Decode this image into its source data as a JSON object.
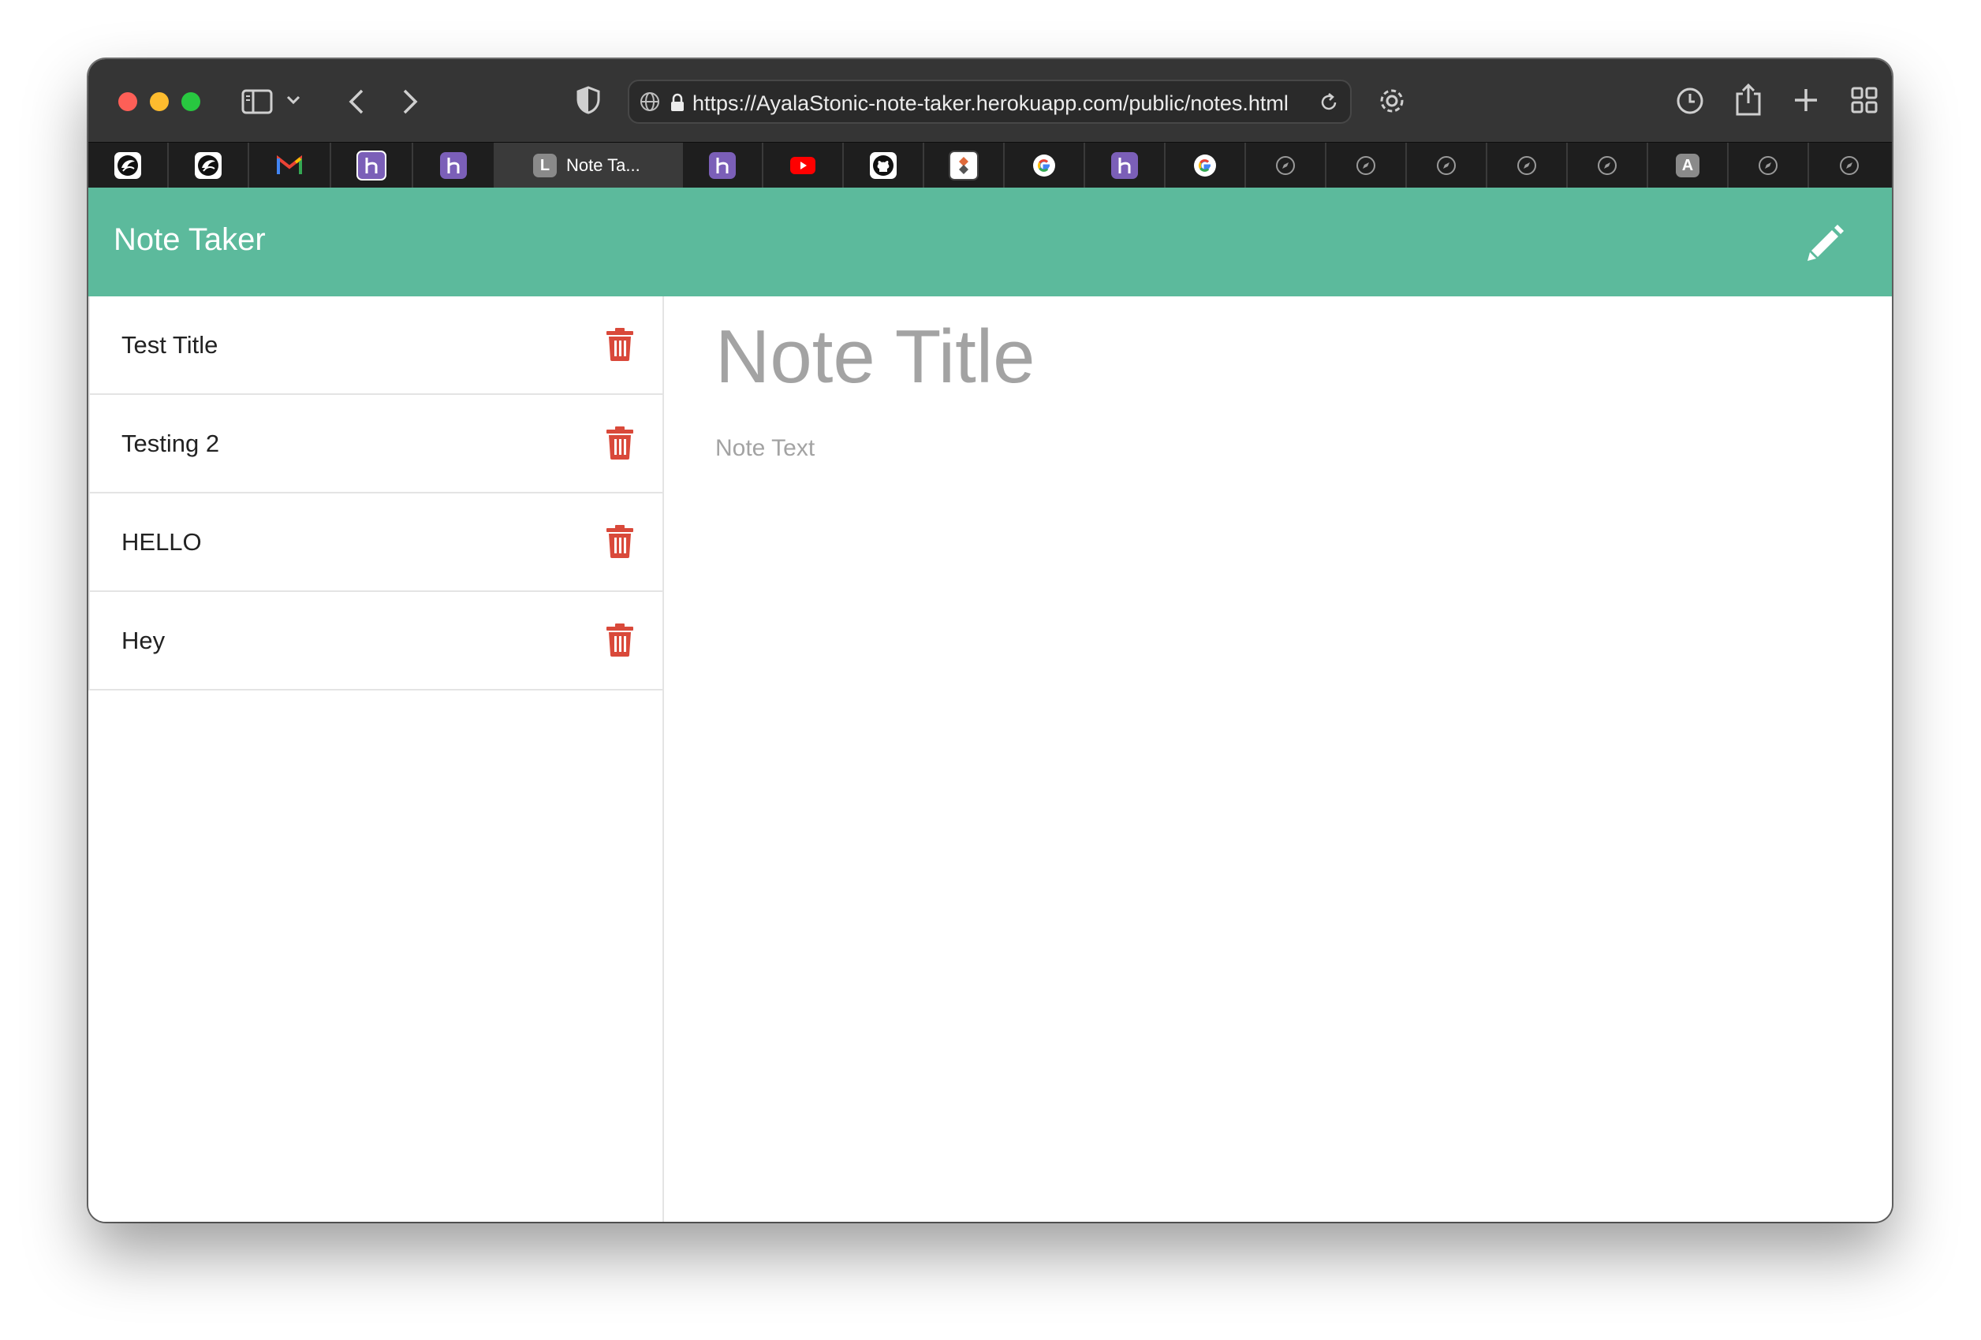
{
  "browser": {
    "url": "https://AyalaStonic-note-taker.herokuapp.com/public/notes.html",
    "active_tab_title": "Note Ta...",
    "active_tab_letter": "L",
    "tabs": [
      {
        "icon": "ucf-pegasus-icon"
      },
      {
        "icon": "ucf-pegasus-icon"
      },
      {
        "icon": "gmail-icon"
      },
      {
        "icon": "heroku-icon"
      },
      {
        "icon": "heroku-icon"
      },
      {
        "icon": "letter-l-icon",
        "active": true
      },
      {
        "icon": "heroku-icon"
      },
      {
        "icon": "youtube-icon"
      },
      {
        "icon": "github-icon"
      },
      {
        "icon": "app-icon"
      },
      {
        "icon": "google-icon"
      },
      {
        "icon": "heroku-icon"
      },
      {
        "icon": "google-icon"
      },
      {
        "icon": "compass-icon"
      },
      {
        "icon": "compass-icon"
      },
      {
        "icon": "compass-icon"
      },
      {
        "icon": "compass-icon"
      },
      {
        "icon": "compass-icon"
      },
      {
        "icon": "letter-a-icon"
      },
      {
        "icon": "compass-icon"
      },
      {
        "icon": "compass-icon"
      }
    ],
    "letter_a": "A"
  },
  "app": {
    "brand": "Note Taker",
    "header_color": "#5cba9c",
    "accent_delete": "#d9493a"
  },
  "notes": [
    {
      "title": "Test Title"
    },
    {
      "title": "Testing 2"
    },
    {
      "title": "HELLO"
    },
    {
      "title": "Hey"
    }
  ],
  "editor": {
    "title_placeholder": "Note Title",
    "text_placeholder": "Note Text"
  }
}
